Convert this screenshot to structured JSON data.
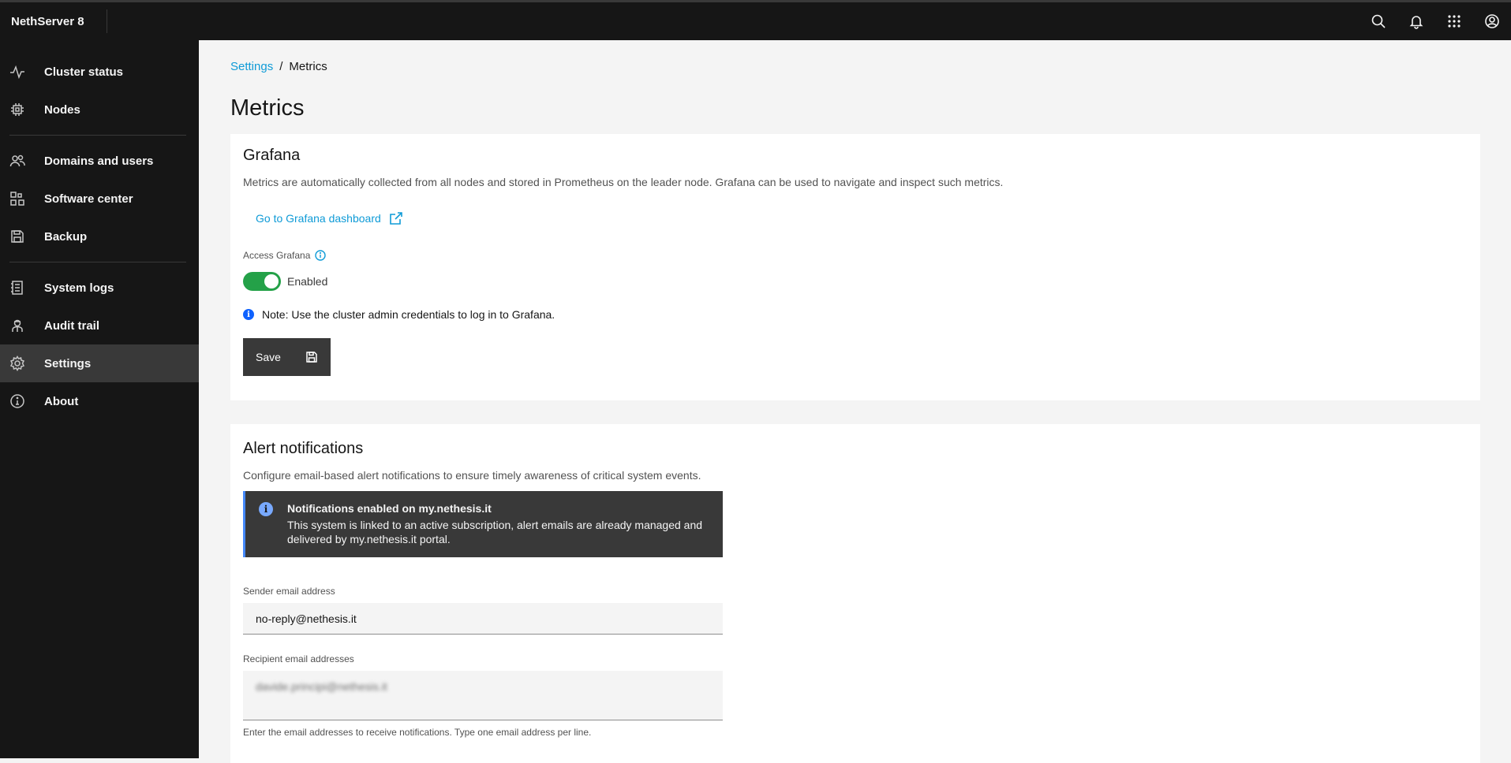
{
  "header": {
    "brand": "NethServer 8"
  },
  "sidebar": {
    "items": [
      {
        "label": "Cluster status",
        "icon": "activity-icon"
      },
      {
        "label": "Nodes",
        "icon": "chip-icon"
      },
      {
        "label": "Domains and users",
        "icon": "users-icon"
      },
      {
        "label": "Software center",
        "icon": "apps-icon"
      },
      {
        "label": "Backup",
        "icon": "save-icon"
      },
      {
        "label": "System logs",
        "icon": "logs-icon"
      },
      {
        "label": "Audit trail",
        "icon": "inspector-icon"
      },
      {
        "label": "Settings",
        "icon": "gear-icon"
      },
      {
        "label": "About",
        "icon": "info-icon"
      }
    ]
  },
  "breadcrumb": {
    "parent": "Settings",
    "separator": "/",
    "current": "Metrics"
  },
  "page": {
    "title": "Metrics"
  },
  "grafana": {
    "title": "Grafana",
    "description": "Metrics are automatically collected from all nodes and stored in Prometheus on the leader node. Grafana can be used to navigate and inspect such metrics.",
    "link_label": "Go to Grafana dashboard",
    "access_label": "Access Grafana",
    "toggle_state": "Enabled",
    "note": "Note: Use the cluster admin credentials to log in to Grafana.",
    "save_label": "Save"
  },
  "alerts": {
    "title": "Alert notifications",
    "description": "Configure email-based alert notifications to ensure timely awareness of critical system events.",
    "notification": {
      "title": "Notifications enabled on my.nethesis.it",
      "body": "This system is linked to an active subscription, alert emails are already managed and delivered by my.nethesis.it portal."
    },
    "sender_label": "Sender email address",
    "sender_value": "no-reply@nethesis.it",
    "recipient_label": "Recipient email addresses",
    "recipient_value": "davide.principi@nethesis.it",
    "recipient_helper": "Enter the email addresses to receive notifications. Type one email address per line."
  },
  "colors": {
    "accent": "#0f9bd7",
    "toggle_on": "#24a148",
    "sidebar_bg": "#161616",
    "active_item": "#393939"
  }
}
